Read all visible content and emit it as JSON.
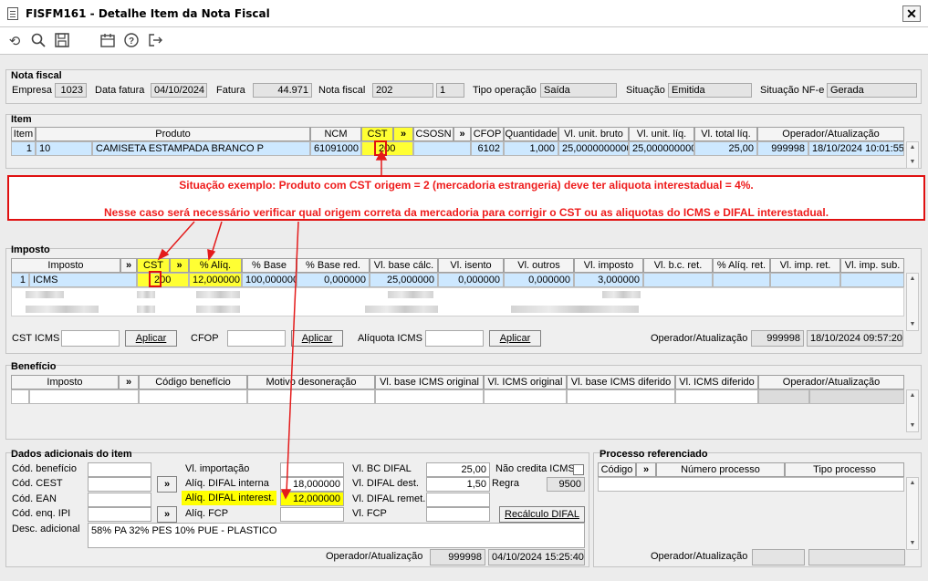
{
  "window": {
    "title": "FISFM161 - Detalhe Item da Nota Fiscal",
    "close_label": "✕"
  },
  "toolbar": {
    "icons": [
      "undo-icon",
      "search-icon",
      "save-icon",
      "calendar-icon",
      "help-icon",
      "exit-icon"
    ]
  },
  "nota_fiscal": {
    "section_title": "Nota fiscal",
    "empresa_label": "Empresa",
    "empresa": "1023",
    "data_fatura_label": "Data fatura",
    "data_fatura": "04/10/2024",
    "fatura_label": "Fatura",
    "fatura": "44.971",
    "nota_fiscal_label": "Nota fiscal",
    "nota_fiscal": "202",
    "serie": "1",
    "tipo_operacao_label": "Tipo operação",
    "tipo_operacao": "Saída",
    "situacao_label": "Situação",
    "situacao": "Emitida",
    "situacao_nfe_label": "Situação NF-e",
    "situacao_nfe": "Gerada"
  },
  "item": {
    "section_title": "Item",
    "columns": [
      "Item",
      "Produto",
      "NCM",
      "CST",
      "»",
      "CSOSN",
      "»",
      "CFOP",
      "Quantidade",
      "Vl. unit. bruto",
      "Vl. unit. líq.",
      "Vl. total líq.",
      "Operador/Atualização"
    ],
    "row": {
      "item": "1",
      "codigo": "10",
      "produto": "CAMISETA ESTAMPADA BRANCO P",
      "ncm": "61091000",
      "cst": "200",
      "cfop": "6102",
      "quantidade": "1,000",
      "vl_unit_bruto": "25,0000000000",
      "vl_unit_liq": "25,0000000000",
      "vl_total_liq": "25,00",
      "operador": "999998",
      "atualizacao": "18/10/2024 10:01:55"
    }
  },
  "annotation": {
    "line1": "Situação exemplo: Produto com CST origem = 2 (mercadoria estrangeria) deve ter aliquota interestadual = 4%.",
    "line2": "Nesse caso será necessário verificar qual origem correta da mercadoria para corrigir o CST ou as aliquotas do ICMS e DIFAL interestadual."
  },
  "imposto": {
    "section_title": "Imposto",
    "columns": [
      "Imposto",
      "»",
      "CST",
      "»",
      "% Alíq.",
      "% Base",
      "% Base red.",
      "Vl. base cálc.",
      "Vl. isento",
      "Vl. outros",
      "Vl. imposto",
      "Vl. b.c. ret.",
      "% Alíq. ret.",
      "Vl. imp. ret.",
      "Vl. imp. sub."
    ],
    "row": {
      "num": "1",
      "imposto": "ICMS",
      "cst": "200",
      "aliq": "12,000000",
      "base": "100,000000",
      "base_red": "0,000000",
      "vl_base_calc": "25,000000",
      "vl_isento": "0,000000",
      "vl_outros": "0,000000",
      "vl_imposto": "3,000000"
    },
    "cst_icms_label": "CST ICMS",
    "aplicar_label": "Aplicar",
    "cfop_label": "CFOP",
    "aliquota_icms_label": "Alíquota ICMS",
    "operador_label": "Operador/Atualização",
    "operador": "999998",
    "atualizacao": "18/10/2024 09:57:20"
  },
  "beneficio": {
    "section_title": "Benefício",
    "columns": [
      "Imposto",
      "»",
      "Código benefício",
      "Motivo desoneração",
      "Vl. base ICMS original",
      "Vl. ICMS original",
      "Vl. base ICMS diferido",
      "Vl. ICMS diferido",
      "Operador/Atualização"
    ]
  },
  "dados": {
    "section_title": "Dados adicionais do item",
    "cod_beneficio_label": "Cód. benefício",
    "cod_cest_label": "Cód. CEST",
    "cod_ean_label": "Cód. EAN",
    "cod_enq_ipi_label": "Cód. enq. IPI",
    "vl_importacao_label": "Vl. importação",
    "aliq_difal_interna_label": "Alíq. DIFAL interna",
    "aliq_difal_interna": "18,000000",
    "aliq_difal_interest_label": "Alíq. DIFAL interest.",
    "aliq_difal_interest": "12,000000",
    "aliq_fcp_label": "Alíq. FCP",
    "vl_bc_difal_label": "Vl. BC DIFAL",
    "vl_bc_difal": "25,00",
    "vl_difal_dest_label": "Vl. DIFAL dest.",
    "vl_difal_dest": "1,50",
    "vl_difal_remet_label": "Vl. DIFAL remet.",
    "vl_fcp_label": "Vl. FCP",
    "nao_credita_label": "Não credita ICMS",
    "regra_label": "Regra",
    "regra": "9500",
    "recalculo_label": "Recálculo DIFAL",
    "desc_adicional_label": "Desc. adicional",
    "desc_adicional": "58% PA 32% PES 10% PUE - PLASTICO",
    "operador_label": "Operador/Atualização",
    "operador": "999998",
    "atualizacao": "04/10/2024 15:25:40"
  },
  "processo": {
    "section_title": "Processo referenciado",
    "columns": [
      "Código",
      "»",
      "Número processo",
      "Tipo processo"
    ],
    "operador_label": "Operador/Atualização"
  },
  "colors": {
    "annotation_red": "#e01010",
    "highlight_yellow": "#ffff00",
    "selected_row": "#cde8ff"
  }
}
